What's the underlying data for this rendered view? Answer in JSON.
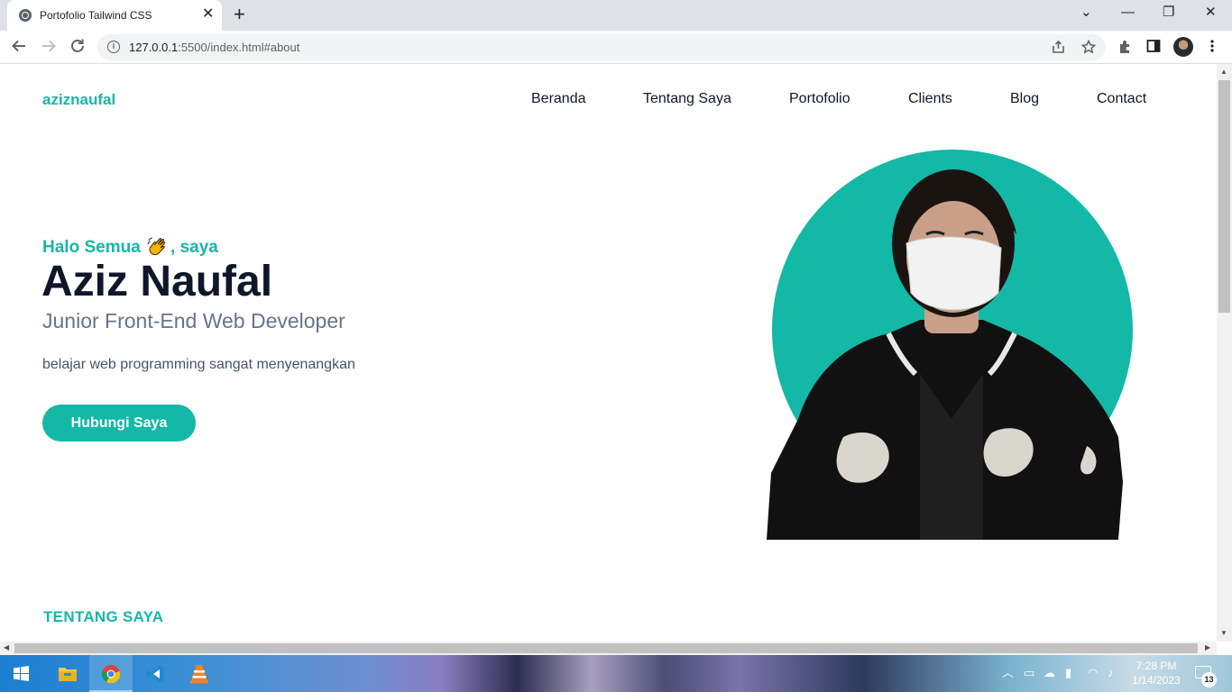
{
  "browser": {
    "tab_title": "Portofolio Tailwind CSS",
    "tab_close": "✕",
    "new_tab": "+",
    "url_host": "127.0.0.1",
    "url_rest": ":5500/index.html#about",
    "window_controls": {
      "minimize": "—",
      "maximize": "❐",
      "close": "✕",
      "tab_search": "⌄"
    }
  },
  "site": {
    "logo": "aziznaufal",
    "nav": [
      {
        "label": "Beranda"
      },
      {
        "label": "Tentang Saya"
      },
      {
        "label": "Portofolio"
      },
      {
        "label": "Clients"
      },
      {
        "label": "Blog"
      },
      {
        "label": "Contact"
      }
    ],
    "hero": {
      "greeting_before": "Halo Semua",
      "greeting_after": ", saya",
      "name": "Aziz Naufal",
      "role": "Junior Front-End Web Developer",
      "description": "belajar web programming sangat menyenangkan",
      "cta_label": "Hubungi Saya",
      "accent_color": "#14b8a6"
    },
    "about_title": "TENTANG SAYA"
  },
  "taskbar": {
    "time": "7:28 PM",
    "date": "1/14/2023",
    "notification_count": "13",
    "apps": [
      "windows-start-icon",
      "file-explorer-icon",
      "chrome-icon",
      "vscode-icon",
      "vlc-icon"
    ]
  }
}
